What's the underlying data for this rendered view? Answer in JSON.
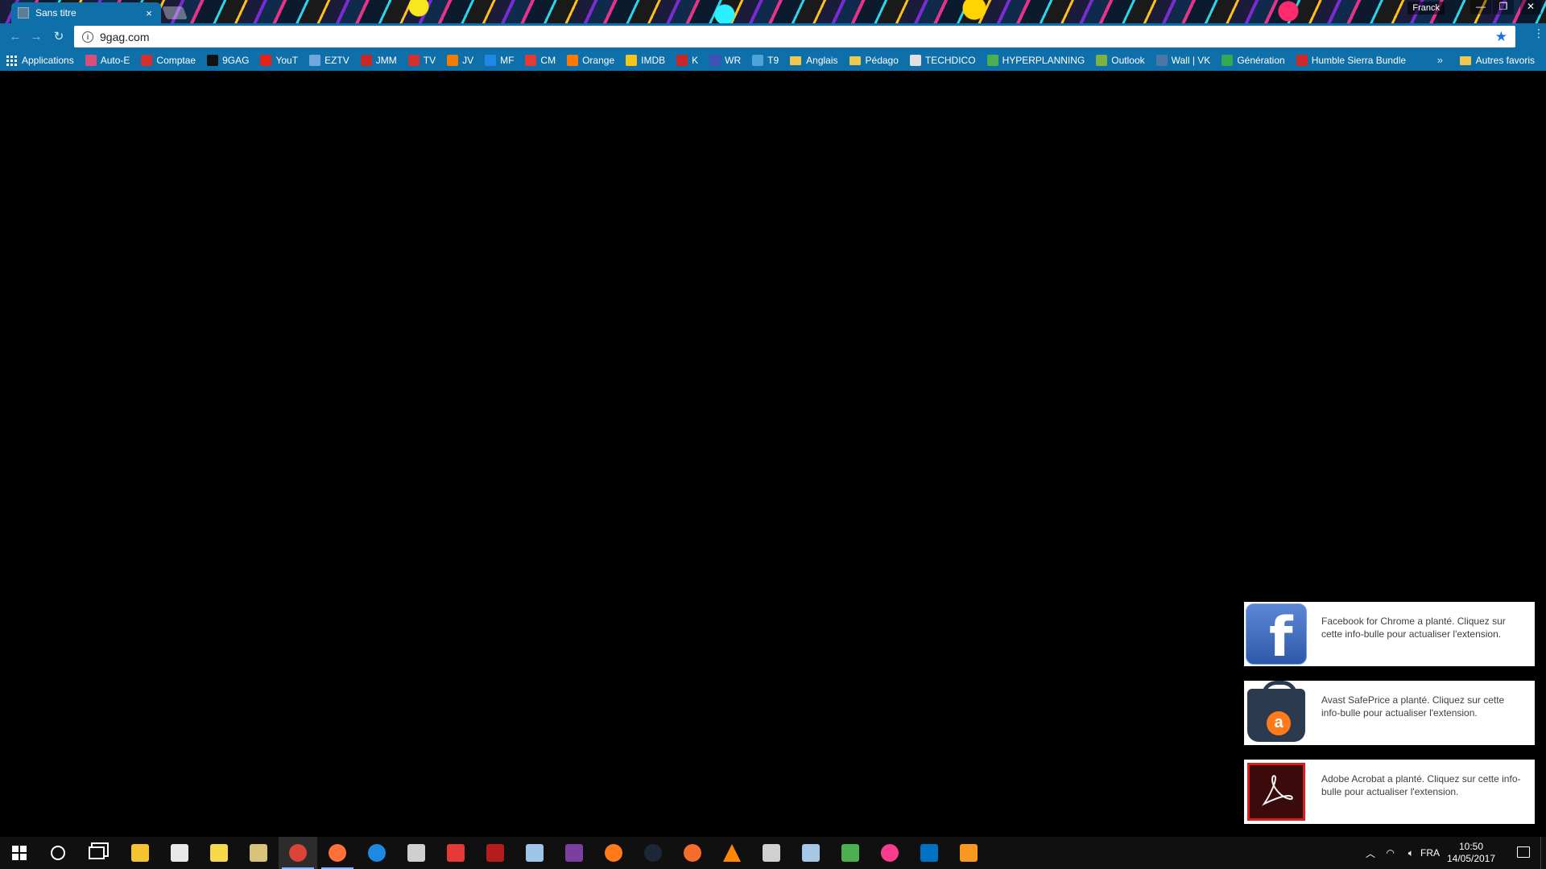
{
  "browser": {
    "tab_title": "Sans titre",
    "tab_close": "×",
    "profile_name": "Franck",
    "window_controls": {
      "minimize": "—",
      "maximize": "❐",
      "close": "✕"
    },
    "nav": {
      "back": "←",
      "forward": "→",
      "reload": "↻"
    },
    "url": "9gag.com",
    "info_icon_glyph": "i",
    "star_glyph": "★",
    "menu_glyph": "⋮"
  },
  "bookmarks": {
    "items": [
      {
        "label": "Applications",
        "icon": "apps-grid-icon",
        "color": "#ffffff"
      },
      {
        "label": "Auto-E",
        "icon": "auto-e-icon",
        "color": "#d94f7a"
      },
      {
        "label": "Comptae",
        "icon": "comptae-icon",
        "color": "#d32f2f"
      },
      {
        "label": "9GAG",
        "icon": "9gag-icon",
        "color": "#111111"
      },
      {
        "label": "YouT",
        "icon": "youtube-icon",
        "color": "#e62117"
      },
      {
        "label": "EZTV",
        "icon": "eztv-icon",
        "color": "#6fa8dc"
      },
      {
        "label": "JMM",
        "icon": "jmm-icon",
        "color": "#c62828"
      },
      {
        "label": "TV",
        "icon": "tv-icon",
        "color": "#d32f2f"
      },
      {
        "label": "JV",
        "icon": "jv-icon",
        "color": "#f57c00"
      },
      {
        "label": "MF",
        "icon": "mf-icon",
        "color": "#1e88e5"
      },
      {
        "label": "CM",
        "icon": "cm-icon",
        "color": "#e53935"
      },
      {
        "label": "Orange",
        "icon": "orange-icon",
        "color": "#ff7900"
      },
      {
        "label": "IMDB",
        "icon": "imdb-icon",
        "color": "#f5c518"
      },
      {
        "label": "K",
        "icon": "k-icon",
        "color": "#c62828"
      },
      {
        "label": "WR",
        "icon": "wr-icon",
        "color": "#3f51b5"
      },
      {
        "label": "T9",
        "icon": "t9-icon",
        "color": "#4fa3d9"
      },
      {
        "label": "Anglais",
        "icon": "folder-icon",
        "color": "#f1c84a"
      },
      {
        "label": "Pédago",
        "icon": "folder-icon",
        "color": "#f1c84a"
      },
      {
        "label": "TECHDICO",
        "icon": "techdico-icon",
        "color": "#e0e0e0"
      },
      {
        "label": "HYPERPLANNING",
        "icon": "hyperplanning-icon",
        "color": "#4caf50"
      },
      {
        "label": "Outlook",
        "icon": "outlook-icon",
        "color": "#7cb342"
      },
      {
        "label": "Wall | VK",
        "icon": "vk-icon",
        "color": "#4a76a8"
      },
      {
        "label": "Génération",
        "icon": "google-icon",
        "color": "#34a853"
      },
      {
        "label": "Humble Sierra Bundle",
        "icon": "humble-icon",
        "color": "#cc2929"
      }
    ],
    "overflow": "»",
    "other_label": "Autres favoris"
  },
  "notifications": [
    {
      "text": "Facebook for Chrome a planté. Cliquez sur cette info-bulle pour actualiser l'extension.",
      "icon": "facebook-icon",
      "icon_glyph": "f"
    },
    {
      "text": "Avast SafePrice a planté. Cliquez sur cette info-bulle pour actualiser l'extension.",
      "icon": "avast-icon",
      "icon_glyph": "a"
    },
    {
      "text": "Adobe Acrobat a planté. Cliquez sur cette info-bulle pour actualiser l'extension.",
      "icon": "acrobat-icon"
    }
  ],
  "taskbar": {
    "apps": [
      {
        "name": "file-explorer",
        "color": "#f4c430"
      },
      {
        "name": "store",
        "color": "#e8e8e8"
      },
      {
        "name": "sticky-notes",
        "color": "#f6d84a"
      },
      {
        "name": "files",
        "color": "#d9c27a"
      },
      {
        "name": "chrome",
        "color": "#db4437"
      },
      {
        "name": "firefox",
        "color": "#ff7139"
      },
      {
        "name": "edge",
        "color": "#1e88e5"
      },
      {
        "name": "calculator",
        "color": "#cfcfcf"
      },
      {
        "name": "ccleaner",
        "color": "#e53935"
      },
      {
        "name": "acrobat",
        "color": "#b71c1c"
      },
      {
        "name": "paint",
        "color": "#9fc5e8"
      },
      {
        "name": "winrar",
        "color": "#7b3fa0"
      },
      {
        "name": "avast",
        "color": "#ff7a18"
      },
      {
        "name": "steam",
        "color": "#1b2838"
      },
      {
        "name": "origin",
        "color": "#f56c2d"
      },
      {
        "name": "vlc",
        "color": "#ff8800"
      },
      {
        "name": "feather",
        "color": "#d0d0d0"
      },
      {
        "name": "mail-app",
        "color": "#a7c7e7"
      },
      {
        "name": "media-app",
        "color": "#4caf50"
      },
      {
        "name": "itunes",
        "color": "#fc3c8d"
      },
      {
        "name": "outlook",
        "color": "#0072c6"
      },
      {
        "name": "java",
        "color": "#f89820"
      }
    ],
    "language": "FRA",
    "time": "10:50",
    "date": "14/05/2017"
  }
}
